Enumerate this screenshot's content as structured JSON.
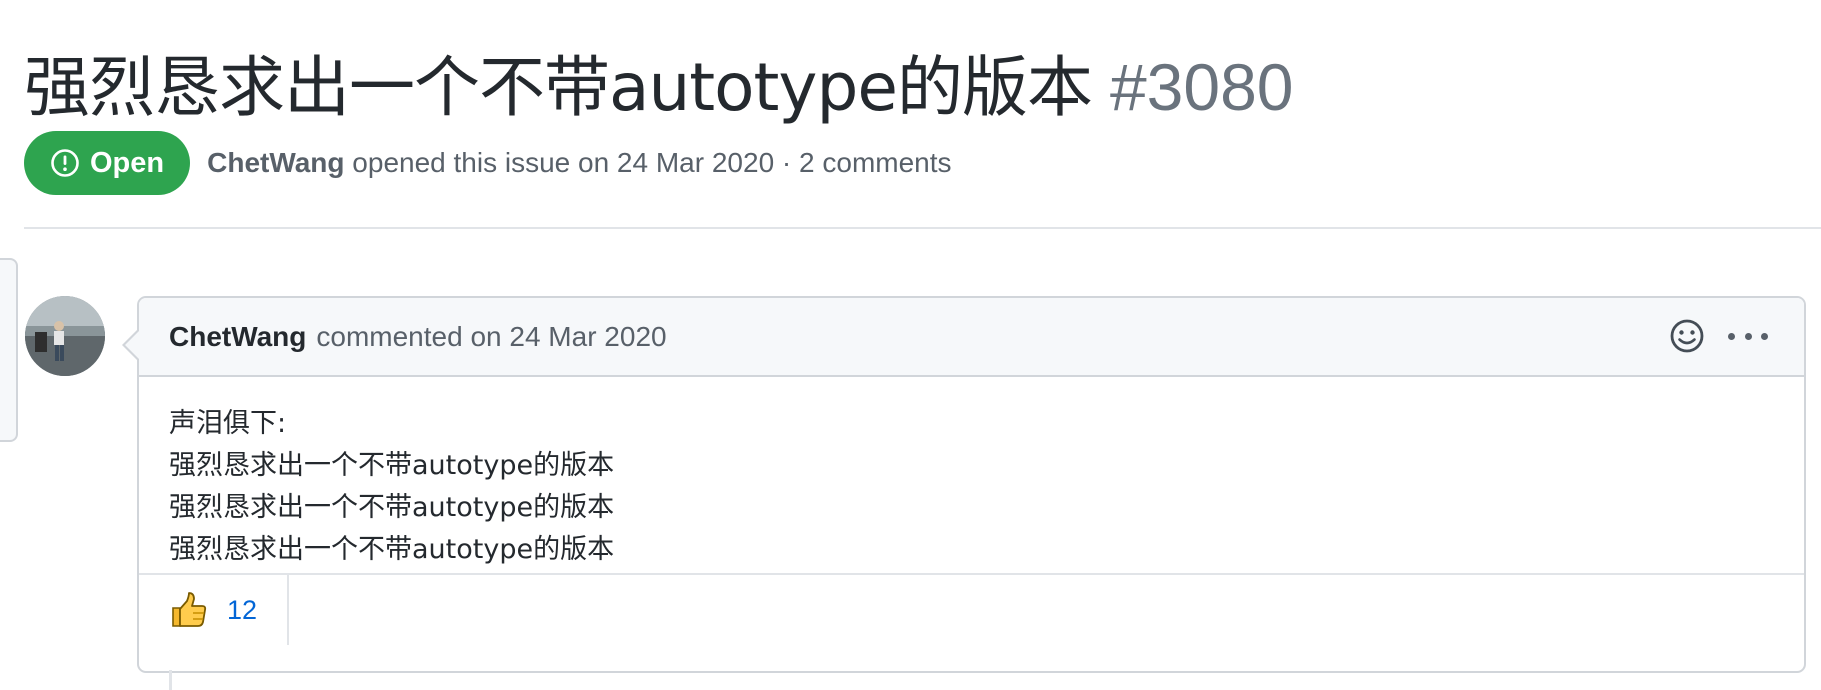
{
  "issue": {
    "title": "强烈恳求出一个不带autotype的版本",
    "number": "#3080",
    "state": "Open",
    "author": "ChetWang",
    "opened_text": "opened this issue on 24 Mar 2020 · 2 comments"
  },
  "comment": {
    "author": "ChetWang",
    "header_text": "commented on 24 Mar 2020",
    "body_lines": [
      "声泪俱下:",
      "强烈恳求出一个不带autotype的版本",
      "强烈恳求出一个不带autotype的版本",
      "强烈恳求出一个不带autotype的版本"
    ],
    "reactions": [
      {
        "icon": "thumbs-up-icon",
        "count": "12"
      }
    ]
  },
  "icons": {
    "state": "issue-opened-icon",
    "emoji": "smiley-icon",
    "more": "kebab-horizontal-icon"
  },
  "colors": {
    "open_green": "#2ea44f",
    "link_blue": "#0366d6",
    "muted": "#586069",
    "border": "#d1d5da"
  }
}
